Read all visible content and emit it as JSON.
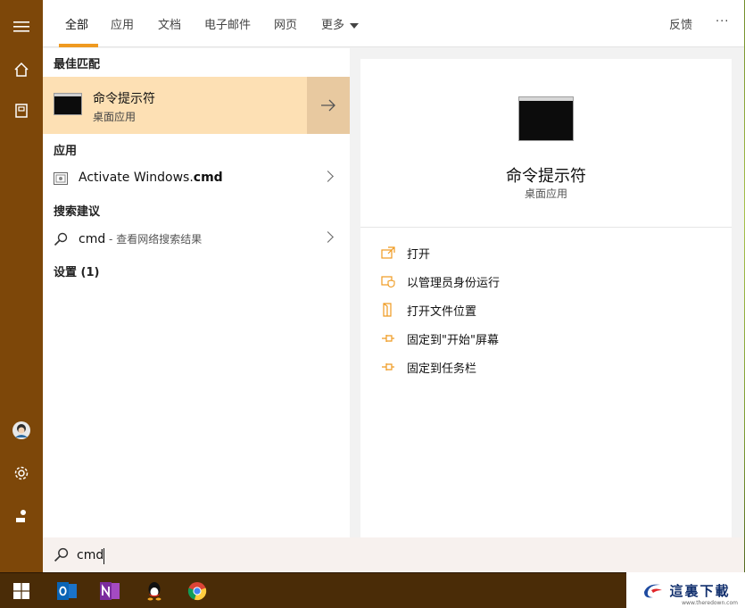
{
  "tabs": [
    "全部",
    "应用",
    "文档",
    "电子邮件",
    "网页",
    "更多"
  ],
  "feedback": "反馈",
  "overflow": "···",
  "sections": {
    "best_match": "最佳匹配",
    "apps": "应用",
    "search_suggestions": "搜索建议",
    "settings": "设置 (1)"
  },
  "best": {
    "name": "命令提示符",
    "type": "桌面应用"
  },
  "app_item": {
    "name_prefix": "Activate Windows.",
    "name_bold": "cmd"
  },
  "suggestion": {
    "query": "cmd",
    "hint": " - 查看网络搜索结果"
  },
  "preview": {
    "title": "命令提示符",
    "subtitle": "桌面应用"
  },
  "actions": [
    {
      "label": "打开",
      "icon": "open-icon"
    },
    {
      "label": "以管理员身份运行",
      "icon": "admin-shield-icon"
    },
    {
      "label": "打开文件位置",
      "icon": "file-location-icon"
    },
    {
      "label": "固定到\"开始\"屏幕",
      "icon": "pin-icon"
    },
    {
      "label": "固定到任务栏",
      "icon": "pin-icon"
    }
  ],
  "search": {
    "value": "cmd"
  },
  "taskbar": [
    "windows-start-icon",
    "outlook-icon",
    "onenote-icon",
    "qq-icon",
    "chrome-icon"
  ],
  "watermark": {
    "text": "這裏下載",
    "url": "www.theredown.com"
  },
  "colors": {
    "accent": "#ef9a20",
    "rail": "#7d4709",
    "best_bg": "#fde0b4",
    "taskbar": "#4a2c07"
  }
}
